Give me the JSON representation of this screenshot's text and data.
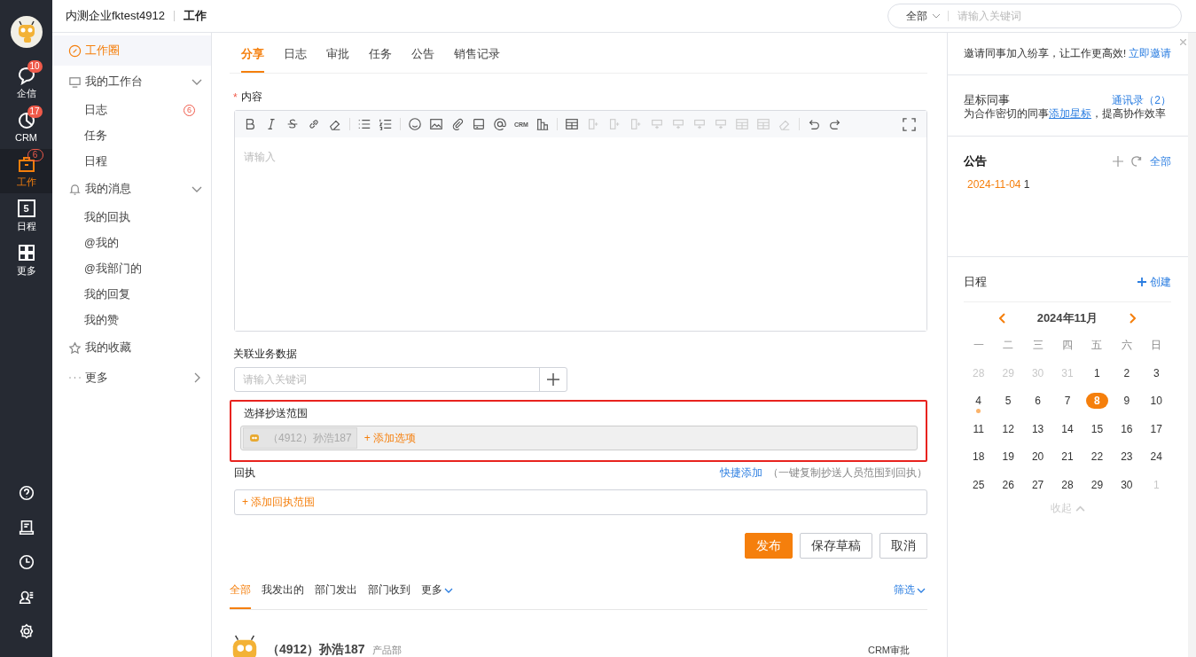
{
  "header": {
    "company": "内测企业fktest4912",
    "section": "工作",
    "search_scope": "全部",
    "search_placeholder": "请输入关键词"
  },
  "rail": {
    "items": [
      {
        "kind": "chat",
        "label": "企信",
        "badge": "10",
        "selected": false
      },
      {
        "kind": "crm",
        "label": "CRM",
        "badge": "17",
        "selected": false
      },
      {
        "kind": "work",
        "label": "工作",
        "badge": "6",
        "selected": true
      },
      {
        "kind": "calendar",
        "label": "日程",
        "icon_text": "5",
        "selected": false
      },
      {
        "kind": "grid",
        "label": "更多",
        "selected": false
      }
    ],
    "bottom": [
      {
        "kind": "help"
      },
      {
        "kind": "book"
      },
      {
        "kind": "clock"
      },
      {
        "kind": "contacts"
      },
      {
        "kind": "settings"
      }
    ]
  },
  "sidebar": {
    "items": [
      {
        "kind": "circle",
        "label": "工作圈",
        "selected": true
      },
      {
        "kind": "desk",
        "label": "我的工作台",
        "expanded": true,
        "children": [
          {
            "label": "日志",
            "badge": "6"
          },
          {
            "label": "任务"
          },
          {
            "label": "日程"
          }
        ]
      },
      {
        "kind": "bell",
        "label": "我的消息",
        "expanded": true,
        "children": [
          {
            "label": "我的回执"
          },
          {
            "label": "@我的"
          },
          {
            "label": "@我部门的"
          },
          {
            "label": "我的回复"
          },
          {
            "label": "我的赞"
          }
        ]
      },
      {
        "kind": "star",
        "label": "我的收藏",
        "selected": false
      },
      {
        "kind": "more",
        "label": "更多",
        "expanded": false
      }
    ]
  },
  "tabs": [
    {
      "label": "分享",
      "selected": true
    },
    {
      "label": "日志",
      "selected": false
    },
    {
      "label": "审批",
      "selected": false
    },
    {
      "label": "任务",
      "selected": false
    },
    {
      "label": "公告",
      "selected": false
    },
    {
      "label": "销售记录",
      "selected": false
    }
  ],
  "editor": {
    "label": "内容",
    "required_mark": "*",
    "placeholder": "请输入",
    "toolbar": [
      [
        {
          "disabled": false
        },
        {
          "disabled": false
        },
        {
          "disabled": false
        },
        {
          "disabled": false
        },
        {
          "disabled": false
        }
      ],
      [
        {
          "disabled": false
        },
        {
          "disabled": false
        }
      ],
      [
        {
          "disabled": false
        },
        {
          "disabled": false
        },
        {
          "disabled": false
        },
        {
          "disabled": false
        },
        {
          "disabled": false
        },
        {
          "kind": "text",
          "label": "CRM",
          "disabled": false
        },
        {
          "disabled": false
        }
      ],
      [
        {
          "disabled": false
        },
        {
          "disabled": true
        },
        {
          "disabled": true
        },
        {
          "disabled": true
        },
        {
          "disabled": true
        },
        {
          "disabled": true
        },
        {
          "disabled": true
        },
        {
          "disabled": true
        },
        {
          "disabled": true
        },
        {
          "disabled": true
        },
        {
          "disabled": true
        }
      ],
      [
        {
          "disabled": false
        },
        {
          "disabled": false
        }
      ]
    ]
  },
  "related": {
    "label": "关联业务数据",
    "placeholder": "请输入关键词"
  },
  "cc": {
    "label": "选择抄送范围",
    "highlighted": true,
    "chips": [
      {
        "text": "（4912）孙浩187"
      }
    ],
    "add": "+ 添加选项"
  },
  "receipt": {
    "label": "回执",
    "quick_add": "快捷添加",
    "hint": "（一键复制抄送人员范围到回执）",
    "add": "+ 添加回执范围"
  },
  "actions": [
    {
      "label": "发布",
      "primary": true
    },
    {
      "label": "保存草稿",
      "primary": false
    },
    {
      "label": "取消",
      "primary": false
    }
  ],
  "feed": {
    "filters": [
      {
        "label": "全部",
        "selected": true
      },
      {
        "label": "我发出的",
        "selected": false
      },
      {
        "label": "部门发出",
        "selected": false
      },
      {
        "label": "部门收到",
        "selected": false
      },
      {
        "label": "更多",
        "selected": false,
        "dropdown": true
      }
    ],
    "filter_button": "筛选",
    "posts": [
      {
        "author": "（4912）孙浩187",
        "dept": "产品部",
        "type": "CRM审批"
      }
    ]
  },
  "right": {
    "invite": {
      "text": "邀请同事加入纷享，让工作更高效!",
      "link": "立即邀请"
    },
    "starred": {
      "title": "星标同事",
      "link": "通讯录（2）",
      "text_before": "为合作密切的同事",
      "text_link": "添加星标",
      "text_after": "，提高协作效率"
    },
    "notices": {
      "title": "公告",
      "all": "全部",
      "items": [
        {
          "date": "2024-11-04",
          "title": "1"
        }
      ]
    },
    "schedule": {
      "title": "日程",
      "create": "创建",
      "month": "2024年11月",
      "weekdays": [
        "一",
        "二",
        "三",
        "四",
        "五",
        "六",
        "日"
      ],
      "weeks": [
        [
          {
            "d": "28",
            "muted": true
          },
          {
            "d": "29",
            "muted": true
          },
          {
            "d": "30",
            "muted": true
          },
          {
            "d": "31",
            "muted": true
          },
          {
            "d": "1"
          },
          {
            "d": "2"
          },
          {
            "d": "3"
          }
        ],
        [
          {
            "d": "4",
            "event": true
          },
          {
            "d": "5"
          },
          {
            "d": "6"
          },
          {
            "d": "7"
          },
          {
            "d": "8",
            "selected": true
          },
          {
            "d": "9"
          },
          {
            "d": "10"
          }
        ],
        [
          {
            "d": "11"
          },
          {
            "d": "12"
          },
          {
            "d": "13"
          },
          {
            "d": "14"
          },
          {
            "d": "15"
          },
          {
            "d": "16"
          },
          {
            "d": "17"
          }
        ],
        [
          {
            "d": "18"
          },
          {
            "d": "19"
          },
          {
            "d": "20"
          },
          {
            "d": "21"
          },
          {
            "d": "22"
          },
          {
            "d": "23"
          },
          {
            "d": "24"
          }
        ],
        [
          {
            "d": "25"
          },
          {
            "d": "26"
          },
          {
            "d": "27"
          },
          {
            "d": "28"
          },
          {
            "d": "29"
          },
          {
            "d": "30"
          },
          {
            "d": "1",
            "muted": true
          }
        ]
      ],
      "collapse": "收起"
    }
  }
}
